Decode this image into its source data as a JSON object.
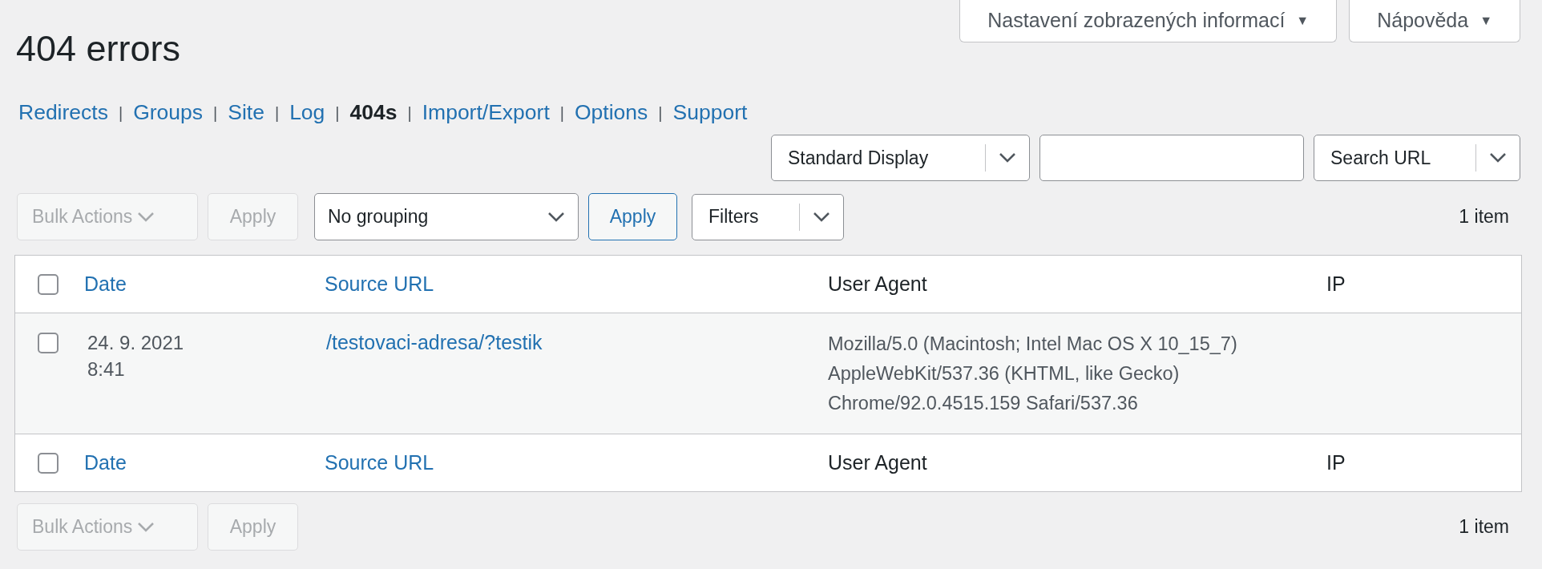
{
  "screen_options": [
    {
      "label": "Nastavení zobrazených informací",
      "symbol": "▼"
    },
    {
      "label": "Nápověda",
      "symbol": "▼"
    }
  ],
  "title": "404 errors",
  "nav": [
    {
      "label": "Redirects",
      "selected": false
    },
    {
      "label": "Groups",
      "selected": false
    },
    {
      "label": "Site",
      "selected": false
    },
    {
      "label": "Log",
      "selected": false
    },
    {
      "label": "404s",
      "selected": true
    },
    {
      "label": "Import/Export",
      "selected": false
    },
    {
      "label": "Options",
      "selected": false
    },
    {
      "label": "Support",
      "selected": false
    }
  ],
  "nav_separator": "|",
  "search_bar": {
    "display_select": "Standard Display",
    "search_select": "Search URL"
  },
  "tablenav_top": {
    "bulk_actions": {
      "label": "Bulk Actions",
      "disabled": true
    },
    "apply": {
      "label": "Apply",
      "disabled": true
    },
    "grouping": "No grouping",
    "grouping_apply": {
      "label": "Apply",
      "disabled": false
    },
    "filters": "Filters",
    "count": "1 item"
  },
  "table": {
    "columns": [
      {
        "label": "Date",
        "sortable": true
      },
      {
        "label": "Source URL",
        "sortable": true
      },
      {
        "label": "User Agent",
        "sortable": false
      },
      {
        "label": "IP",
        "sortable": false
      }
    ],
    "select_all_checked": false,
    "rows": [
      {
        "checked": false,
        "date": [
          "24. 9. 2021",
          "8:41"
        ],
        "source_url": "/testovaci-adresa/?testik",
        "user_agent": [
          "Mozilla/5.0 (Macintosh; Intel Mac OS X 10_15_7)",
          "AppleWebKit/537.36 (KHTML, like Gecko)",
          "Chrome/92.0.4515.159 Safari/537.36"
        ]
      }
    ],
    "footer_columns": [
      {
        "label": "Date",
        "sortable": true
      },
      {
        "label": "Source URL",
        "sortable": true
      },
      {
        "label": "User Agent",
        "sortable": false
      },
      {
        "label": "IP",
        "sortable": false
      }
    ],
    "footer_select_all_checked": false
  },
  "tablenav_bottom": {
    "bulk_actions": {
      "label": "Bulk Actions",
      "disabled": true
    },
    "apply": {
      "label": "Apply",
      "disabled": true
    },
    "count": "1 item"
  }
}
